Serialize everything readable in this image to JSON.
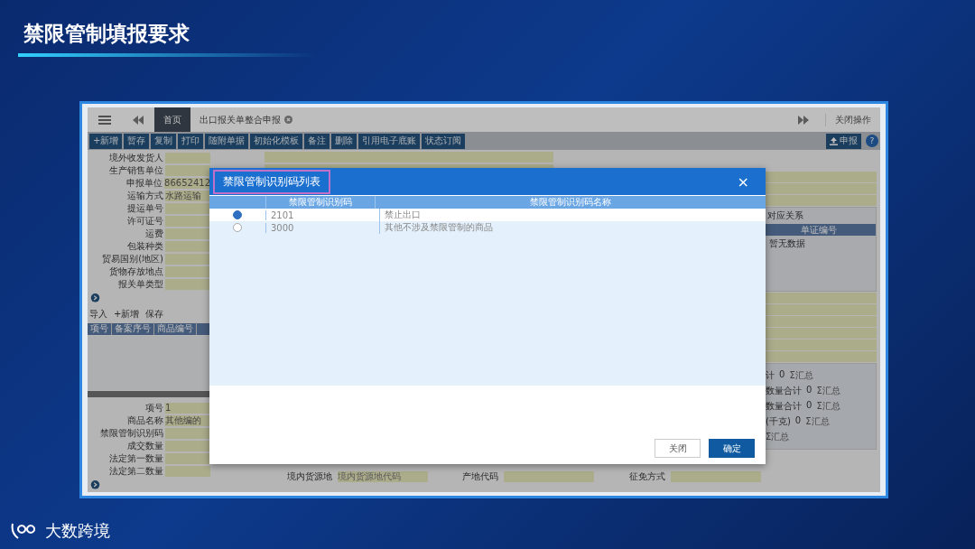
{
  "slide": {
    "title": "禁限管制填报要求",
    "logo_text": "大数跨境"
  },
  "tabbar": {
    "tabs": [
      {
        "label": "首页",
        "selected": true,
        "closable": false
      },
      {
        "label": "出口报关单整合申报",
        "selected": false,
        "closable": true
      }
    ],
    "right_action": "关闭操作"
  },
  "toolbar": {
    "buttons": [
      "+新增",
      "暂存",
      "复制",
      "打印",
      "随附单据",
      "初始化模板",
      "备注",
      "删除",
      "引用电子底账",
      "状态订阅"
    ],
    "declare_button": "申报",
    "help": "?"
  },
  "form_fields": [
    {
      "label": "境外收发货人"
    },
    {
      "label": "生产销售单位"
    },
    {
      "label": "申报单位",
      "value": "86652412"
    },
    {
      "label": "运输方式",
      "value": "水路运输"
    },
    {
      "label": "提运单号"
    },
    {
      "label": "许可证号"
    },
    {
      "label": "运费"
    },
    {
      "label": "包装种类"
    },
    {
      "label": "贸易国别(地区)"
    },
    {
      "label": "货物存放地点"
    },
    {
      "label": "报关单类型"
    }
  ],
  "item_toolbar": [
    "导入",
    "+新增",
    "保存"
  ],
  "item_columns": [
    "项号",
    "备案序号",
    "商品编号"
  ],
  "item_fields": [
    {
      "label": "项号",
      "value": "1"
    },
    {
      "label": "商品名称",
      "value": "其他编的"
    },
    {
      "label": "禁限管制识别码"
    },
    {
      "label": "成交数量"
    },
    {
      "label": "法定第一数量"
    },
    {
      "label": "法定第二数量"
    }
  ],
  "relation_panel": {
    "title": "对应关系",
    "column": "单证编号",
    "empty": "暂无数据"
  },
  "totals": [
    {
      "label": "计",
      "value": "0",
      "action": "Σ汇总"
    },
    {
      "label": "数量合计",
      "value": "0",
      "action": "Σ汇总"
    },
    {
      "label": "数量合计",
      "value": "0",
      "action": "Σ汇总"
    },
    {
      "label": "(千克)",
      "value": "0",
      "action": "Σ汇总"
    },
    {
      "action": "Σ汇总"
    }
  ],
  "bottom_fields": [
    {
      "label": "境内货源地",
      "placeholder": "境内货源地代码"
    },
    {
      "label": "产地代码"
    },
    {
      "label": "征免方式"
    }
  ],
  "dialog": {
    "title": "禁限管制识别码列表",
    "close": "×",
    "columns": [
      "禁限管制识别码",
      "禁限管制识别码名称"
    ],
    "rows": [
      {
        "selected": true,
        "code": "2101",
        "name": "禁止出口"
      },
      {
        "selected": false,
        "code": "3000",
        "name": "其他不涉及禁限管制的商品"
      }
    ],
    "buttons": [
      {
        "label": "关闭",
        "kind": "secondary"
      },
      {
        "label": "确定",
        "kind": "primary"
      }
    ]
  }
}
